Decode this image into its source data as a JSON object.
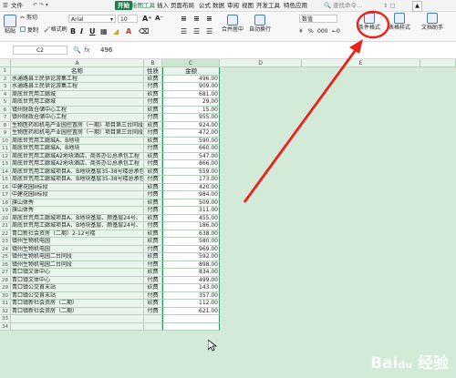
{
  "menubar": {
    "doc_icon": "☰",
    "file_label": "文件",
    "items": [
      "开始",
      "插入",
      "页面布局",
      "公式",
      "数据",
      "审阅",
      "视图",
      "开发工具",
      "特色应用"
    ],
    "tools_label": "绘图工具",
    "search_placeholder": "查找命令..."
  },
  "ribbon": {
    "cut": "剪切",
    "paste": "粘贴",
    "copy": "复制",
    "format_painter": "格式刷",
    "font_name": "Arial",
    "font_size": "10",
    "bold": "B",
    "italic": "I",
    "underline": "U",
    "merge": "合并居中",
    "wrap": "自动换行",
    "number_format": "数值",
    "percent": "%",
    "comma": "000",
    "conditional_format": "条件格式",
    "table_style": "表格样式",
    "doc_assistant": "文档助手",
    "accent_color": "#1f7c4d",
    "highlight_circle_color": "#e8231c"
  },
  "formula_bar": {
    "name_box": "C2",
    "fx": "fx",
    "value": "496"
  },
  "columns": [
    "A",
    "B",
    "C",
    "D",
    "E"
  ],
  "header": {
    "name": "名称",
    "nature": "性质",
    "amount": "金额"
  },
  "rows": [
    {
      "n": "2",
      "name": "水通路县土民供论游集工程",
      "type": "砍费",
      "amt": "496.00"
    },
    {
      "n": "3",
      "name": "水通路县土民供论游集工程",
      "type": "付费",
      "amt": "909.00"
    },
    {
      "n": "4",
      "name": "周底世荒用工廊城",
      "type": "砍费",
      "amt": "681.00"
    },
    {
      "n": "5",
      "name": "周底世荒用工廊城",
      "type": "付费",
      "amt": "29.00"
    },
    {
      "n": "6",
      "name": "镇州财政仓储中心工程",
      "type": "砍费",
      "amt": "15.00"
    },
    {
      "n": "7",
      "name": "镇州财政仓储中心工程",
      "type": "付费",
      "amt": "955.00"
    },
    {
      "n": "8",
      "name": "生物医药和机电产业园控置房（一期）项目第三台同段",
      "type": "砍费",
      "amt": "924.00"
    },
    {
      "n": "9",
      "name": "生物医药和机电产业园控置房（一期）项目第三台同段",
      "type": "付费",
      "amt": "472.00"
    },
    {
      "n": "10",
      "name": "周底世荒用工廊城A、B地块",
      "type": "砍费",
      "amt": "590.00"
    },
    {
      "n": "11",
      "name": "周底世荒用工廊城A、B地块",
      "type": "付费",
      "amt": "660.00"
    },
    {
      "n": "12",
      "name": "周底世荒用工廊城A2地块酒店、商务办公总承包工程",
      "type": "砍费",
      "amt": "547.00"
    },
    {
      "n": "13",
      "name": "周底世荒用工廊城A2地块酒店、商务办公总承包工程",
      "type": "付费",
      "amt": "866.00"
    },
    {
      "n": "14",
      "name": "周底世荒用工廊城项目A、B地块基层35-38号楼总承包",
      "type": "砍费",
      "amt": "559.00"
    },
    {
      "n": "15",
      "name": "周底世荒用工廊城项目A、B地块基层35-38号楼总承包",
      "type": "付费",
      "amt": "173.00"
    },
    {
      "n": "16",
      "name": "中建花园II标段",
      "type": "砍费",
      "amt": "420.00"
    },
    {
      "n": "17",
      "name": "中建花园II标段",
      "type": "付费",
      "amt": "984.00"
    },
    {
      "n": "18",
      "name": "旗山体秀",
      "type": "砍费",
      "amt": "509.00"
    },
    {
      "n": "19",
      "name": "旗山体秀",
      "type": "付费",
      "amt": "311.00"
    },
    {
      "n": "20",
      "name": "周底世荒用工廊城项目A、B地块基层、颜基层24号、",
      "type": "砍费",
      "amt": "455.00"
    },
    {
      "n": "21",
      "name": "周底世荒用工廊城项目A、B地块基层、颜基层24号、",
      "type": "付费",
      "amt": "186.00"
    },
    {
      "n": "22",
      "name": "青口新社会资房（二期）2-12号楼",
      "type": "砍费",
      "amt": "638.00"
    },
    {
      "n": "23",
      "name": "镇州生物机电园",
      "type": "砍费",
      "amt": "580.00"
    },
    {
      "n": "24",
      "name": "镇州生物机电园",
      "type": "付费",
      "amt": "969.00"
    },
    {
      "n": "25",
      "name": "镇州生物机电园二台同段",
      "type": "砍费",
      "amt": "592.00"
    },
    {
      "n": "26",
      "name": "镇州生物机电园二台同段",
      "type": "付费",
      "amt": "898.00"
    },
    {
      "n": "27",
      "name": "青口镇文体中心",
      "type": "砍费",
      "amt": "834.00"
    },
    {
      "n": "28",
      "name": "青口镇文体中心",
      "type": "付费",
      "amt": "499.00"
    },
    {
      "n": "29",
      "name": "青口镇公交首末站",
      "type": "砍费",
      "amt": "143.00"
    },
    {
      "n": "30",
      "name": "青口镇公交首末站",
      "type": "付费",
      "amt": "357.00"
    },
    {
      "n": "31",
      "name": "青口镇新社会资房（二期）",
      "type": "砍费",
      "amt": "112.00"
    },
    {
      "n": "32",
      "name": "青口镇新社会资房（二期）",
      "type": "付费",
      "amt": "621.00"
    }
  ],
  "extra_rows": [
    "33",
    "34"
  ],
  "watermark": "Bai du 经验"
}
